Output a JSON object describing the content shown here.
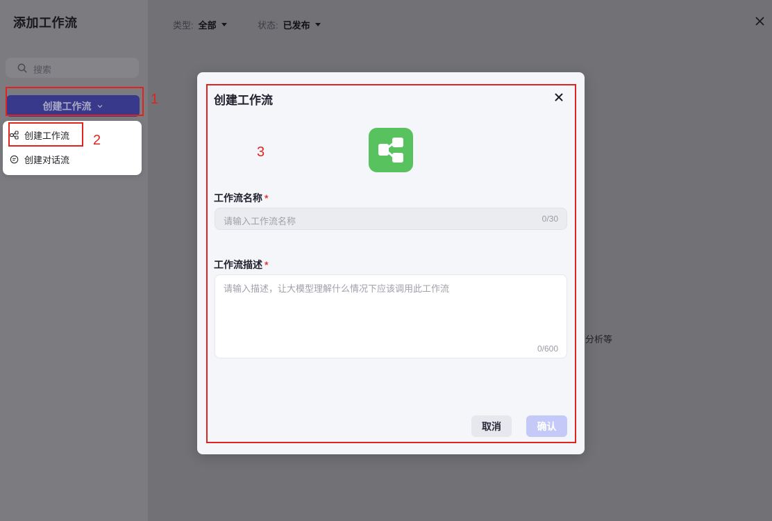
{
  "panel": {
    "title": "添加工作流",
    "search_placeholder": "搜索",
    "search_icon": "search-icon",
    "create_button_label": "创建工作流",
    "menu": [
      {
        "label": "创建工作流",
        "icon": "workflow-icon"
      },
      {
        "label": "创建对话流",
        "icon": "chat-flow-icon"
      }
    ]
  },
  "filters": [
    {
      "label": "类型:",
      "value": "全部"
    },
    {
      "label": "状态:",
      "value": "已发布"
    }
  ],
  "background_text": "分析等",
  "modal": {
    "title": "创建工作流",
    "icon": "workflow-icon",
    "name_field": {
      "label": "工作流名称",
      "required_mark": "*",
      "placeholder": "请输入工作流名称",
      "counter": "0/30"
    },
    "desc_field": {
      "label": "工作流描述",
      "required_mark": "*",
      "placeholder": "请输入描述，让大模型理解什么情况下应该调用此工作流",
      "counter": "0/600"
    },
    "cancel_label": "取消",
    "confirm_label": "确认"
  },
  "annotations": [
    {
      "label": "1"
    },
    {
      "label": "2"
    },
    {
      "label": "3"
    }
  ],
  "colors": {
    "annotation": "#e0241d",
    "create_button": "#38398a",
    "flow_icon_bg": "#58c35e",
    "confirm_button": "#c4c9f7",
    "required_mark": "#e53935"
  }
}
